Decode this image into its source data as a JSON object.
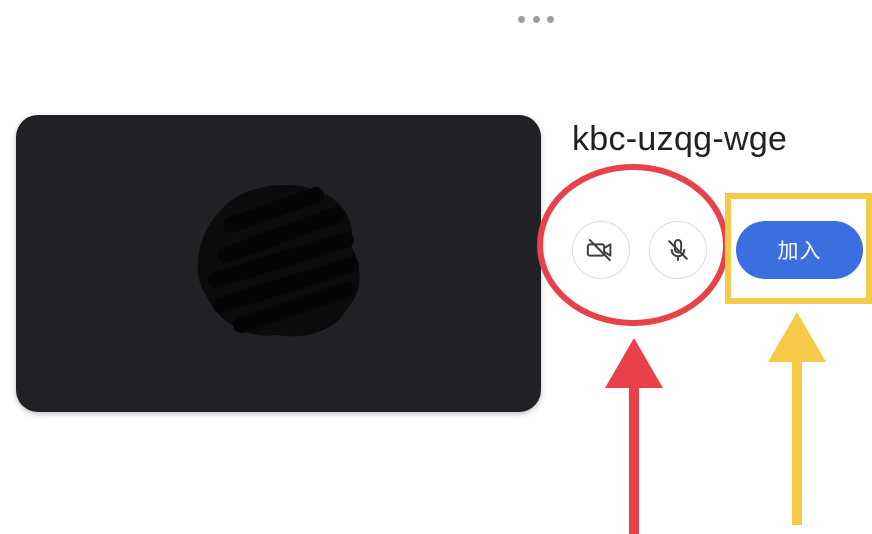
{
  "header": {
    "more_icon": "more-horiz-icon"
  },
  "meeting": {
    "code": "kbc-uzqg-wge"
  },
  "controls": {
    "camera_icon": "videocam-off-icon",
    "mic_icon": "mic-off-icon",
    "join_label": "加入"
  },
  "annotations": {
    "red_color": "#e8414a",
    "yellow_color": "#f7c948"
  },
  "colors": {
    "video_bg": "#202124",
    "join_blue": "#3b6fe0"
  }
}
